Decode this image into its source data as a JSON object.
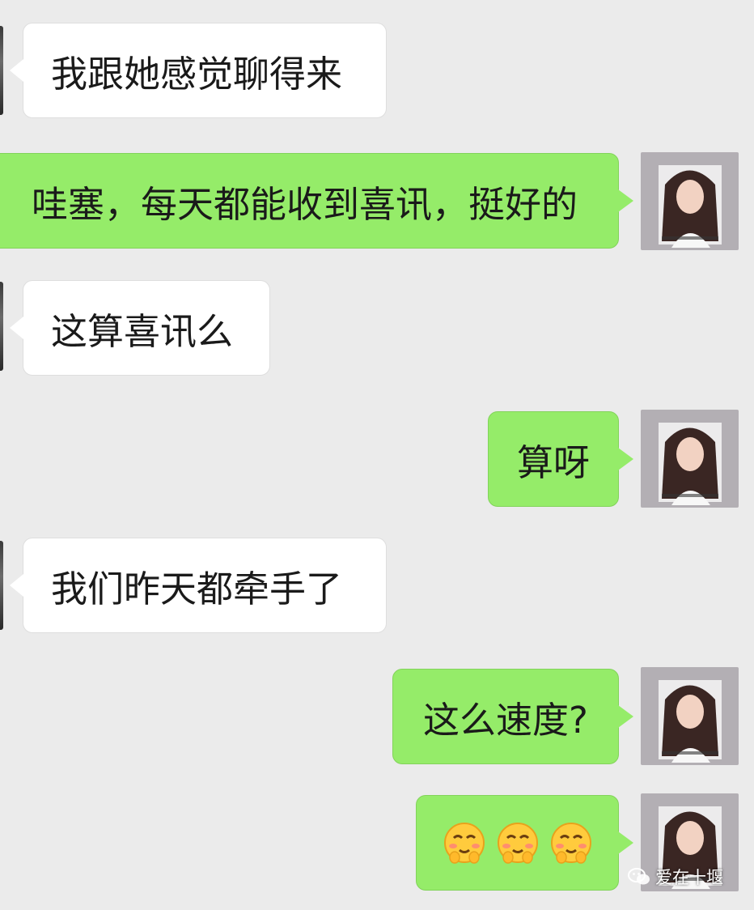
{
  "messages": [
    {
      "side": "received",
      "text": "我跟她感觉聊得来"
    },
    {
      "side": "sent",
      "text": "哇塞，每天都能收到喜讯，挺好的"
    },
    {
      "side": "received",
      "text": "这算喜讯么"
    },
    {
      "side": "sent",
      "text": "算呀"
    },
    {
      "side": "received",
      "text": "我们昨天都牵手了"
    },
    {
      "side": "sent",
      "text": "这么速度?"
    },
    {
      "side": "sent",
      "emoji": [
        "shy-smiling-face-emoji",
        "shy-smiling-face-emoji",
        "shy-smiling-face-emoji"
      ]
    }
  ],
  "watermark": {
    "text": "爱在十堰",
    "icon": "wechat-icon"
  },
  "colors": {
    "background": "#ebebeb",
    "sent_bubble": "#95ec69",
    "received_bubble": "#ffffff"
  }
}
